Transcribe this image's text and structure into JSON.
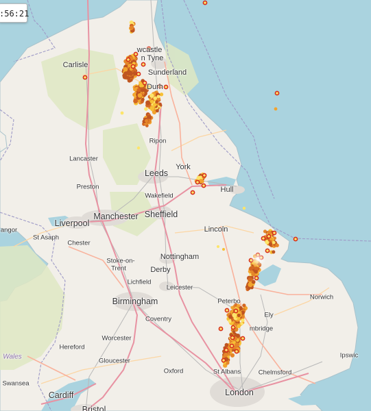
{
  "time_display": ":56:21",
  "places": [
    {
      "id": "newcastle-a",
      "text": "wcastle",
      "cls": "med"
    },
    {
      "id": "newcastle-b",
      "text": "n Tyne",
      "cls": "med"
    },
    {
      "id": "sunderland",
      "text": "Sunderland",
      "cls": "med"
    },
    {
      "id": "durham",
      "text": "Durh",
      "cls": "med"
    },
    {
      "id": "carlisle",
      "text": "Carlisle",
      "cls": "med"
    },
    {
      "id": "ripon",
      "text": "Ripon",
      "cls": "sm"
    },
    {
      "id": "lancaster",
      "text": "Lancaster",
      "cls": "sm"
    },
    {
      "id": "york",
      "text": "York",
      "cls": "med"
    },
    {
      "id": "leeds",
      "text": "Leeds",
      "cls": "big"
    },
    {
      "id": "hull",
      "text": "Hull",
      "cls": "med"
    },
    {
      "id": "preston",
      "text": "Preston",
      "cls": "sm"
    },
    {
      "id": "wakefield",
      "text": "Wakefield",
      "cls": "sm"
    },
    {
      "id": "liverpool",
      "text": "Liverpool",
      "cls": "big"
    },
    {
      "id": "manchester",
      "text": "Manchester",
      "cls": "big"
    },
    {
      "id": "sheffield",
      "text": "Sheffield",
      "cls": "big"
    },
    {
      "id": "lincoln",
      "text": "Lincoln",
      "cls": "med"
    },
    {
      "id": "angor",
      "text": "angor",
      "cls": "sm"
    },
    {
      "id": "st-asaph",
      "text": "St Asaph",
      "cls": "sm"
    },
    {
      "id": "chester",
      "text": "Chester",
      "cls": "sm"
    },
    {
      "id": "nottingham",
      "text": "Nottingham",
      "cls": "med"
    },
    {
      "id": "stoke-a",
      "text": "Stoke-on-",
      "cls": "sm"
    },
    {
      "id": "stoke-b",
      "text": "Trent",
      "cls": "sm"
    },
    {
      "id": "derby",
      "text": "Derby",
      "cls": "med"
    },
    {
      "id": "lichfield",
      "text": "Lichfield",
      "cls": "sm"
    },
    {
      "id": "leicester",
      "text": "Leicester",
      "cls": "sm"
    },
    {
      "id": "birmingham",
      "text": "Birmingham",
      "cls": "big"
    },
    {
      "id": "norwich",
      "text": "Norwich",
      "cls": "sm"
    },
    {
      "id": "coventry",
      "text": "Coventry",
      "cls": "sm"
    },
    {
      "id": "peterborough",
      "text": "Peterbo",
      "cls": "sm"
    },
    {
      "id": "ely",
      "text": "Ely",
      "cls": "sm"
    },
    {
      "id": "cambridge",
      "text": "mbridge",
      "cls": "sm"
    },
    {
      "id": "worcester",
      "text": "Worcester",
      "cls": "sm"
    },
    {
      "id": "hereford",
      "text": "Hereford",
      "cls": "sm"
    },
    {
      "id": "wales",
      "text": "Wales",
      "cls": "region"
    },
    {
      "id": "gloucester",
      "text": "Gloucester",
      "cls": "sm"
    },
    {
      "id": "ipswich",
      "text": "Ipswic",
      "cls": "sm"
    },
    {
      "id": "oxford",
      "text": "Oxford",
      "cls": "sm"
    },
    {
      "id": "chelmsford",
      "text": "Chelmsford",
      "cls": "sm"
    },
    {
      "id": "st-albans",
      "text": "St Albans",
      "cls": "sm"
    },
    {
      "id": "swansea",
      "text": "Swansea",
      "cls": "sm"
    },
    {
      "id": "cardiff",
      "text": "Cardiff",
      "cls": "big"
    },
    {
      "id": "london",
      "text": "London",
      "cls": "big"
    },
    {
      "id": "bristol",
      "text": "Bristol",
      "cls": "big"
    }
  ],
  "colors": {
    "sea": "#aad3df",
    "land": "#f2efe9",
    "moor": "#dfe8c3",
    "urban": "#e0dcd7",
    "motorway": "#e892a2",
    "trunk": "#f9b29c",
    "minor": "#fcd6a4",
    "border": "#9e9ac7",
    "rail": "#bbbbbb",
    "strike_palette": [
      "#fde46a",
      "#f7c035",
      "#f2a32e",
      "#e5862a",
      "#d46823",
      "#bf5520"
    ],
    "recent_ring": "#d62e1c"
  }
}
